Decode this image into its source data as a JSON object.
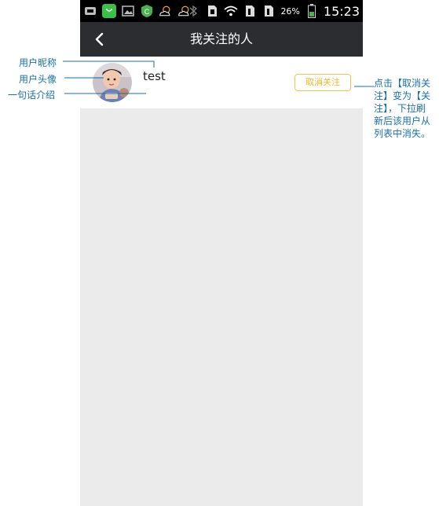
{
  "status_bar": {
    "battery_percent": "26%",
    "time": "15:23",
    "icons": [
      "usb-icon",
      "shopping-bag-icon",
      "image-icon",
      "security-shield-icon",
      "weather-sun-cloud-icon",
      "weather-sun-cloud-icon",
      "bluetooth-icon",
      "sim-icon",
      "wifi-icon",
      "signal-icon",
      "signal-icon",
      "battery-icon"
    ]
  },
  "header": {
    "title": "我关注的人"
  },
  "list": {
    "items": [
      {
        "nickname": "test",
        "bio": "",
        "button_label": "取消关注"
      }
    ]
  },
  "annotations": {
    "nickname": "用户昵称",
    "avatar": "用户头像",
    "bio": "一句话介绍",
    "unfollow_note": "点击【取消关注】变为【关注】，下拉刷新后该用户从列表中消失。"
  },
  "colors": {
    "title_bar": "#2b2d30",
    "status_bar": "#000000",
    "background": "#ebebeb",
    "accent_button": "#f4c44a",
    "annotation": "#1a6fa8"
  }
}
